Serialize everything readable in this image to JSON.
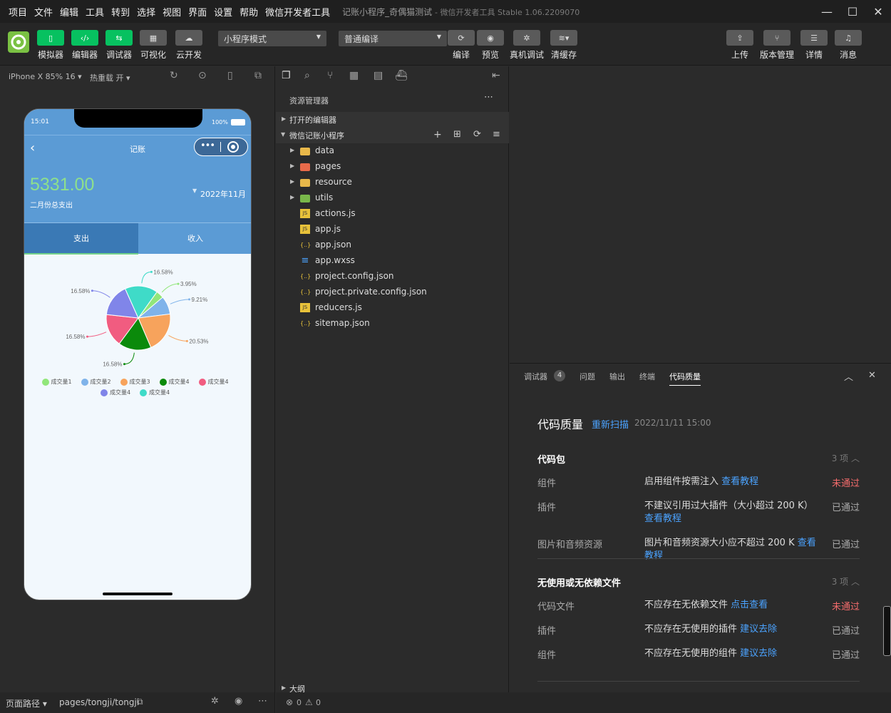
{
  "menu": [
    "项目",
    "文件",
    "编辑",
    "工具",
    "转到",
    "选择",
    "视图",
    "界面",
    "设置",
    "帮助",
    "微信开发者工具"
  ],
  "window": {
    "title": "记账小程序_奇偶猫测试",
    "subtitle": "- 微信开发者工具 Stable 1.06.2209070"
  },
  "toolbar": {
    "left_buttons": [
      {
        "label": "模拟器",
        "icon": "phone-icon"
      },
      {
        "label": "编辑器",
        "icon": "code-icon"
      },
      {
        "label": "调试器",
        "icon": "sliders-icon"
      },
      {
        "label": "可视化",
        "icon": "layout-icon"
      },
      {
        "label": "云开发",
        "icon": "cloud-icon"
      }
    ],
    "mode_select": "小程序模式",
    "compile_select": "普通编译",
    "mid_buttons": [
      {
        "label": "编译",
        "icon": "refresh-icon"
      },
      {
        "label": "预览",
        "icon": "eye-icon"
      },
      {
        "label": "真机调试",
        "icon": "bug-icon"
      },
      {
        "label": "清缓存",
        "icon": "layers-icon"
      }
    ],
    "right_buttons": [
      {
        "label": "上传",
        "icon": "upload-icon"
      },
      {
        "label": "版本管理",
        "icon": "branch-icon"
      },
      {
        "label": "详情",
        "icon": "menu-icon"
      },
      {
        "label": "消息",
        "icon": "bell-icon"
      }
    ]
  },
  "simulator": {
    "device": "iPhone X 85% 16 ▾",
    "hot_reload": "热重载 开 ▾",
    "phone": {
      "time": "15:01",
      "battery": "100%",
      "nav_title": "记账",
      "total": "5331.00",
      "total_label": "二月份总支出",
      "month": "2022年11月",
      "tab_out": "支出",
      "tab_in": "收入"
    }
  },
  "chart_data": {
    "type": "pie",
    "slices": [
      {
        "name": "成交量1",
        "value": 3.95,
        "label": "3.95%",
        "color": "#91e67a"
      },
      {
        "name": "成交量2",
        "value": 9.21,
        "label": "9.21%",
        "color": "#7fb3ea"
      },
      {
        "name": "成交量3",
        "value": 20.53,
        "label": "20.53%",
        "color": "#f7a35c"
      },
      {
        "name": "成交量4",
        "value": 16.58,
        "label": "16.58%",
        "color": "#0b8a0b"
      },
      {
        "name": "成交量4",
        "value": 16.58,
        "label": "16.58%",
        "color": "#f15c80"
      },
      {
        "name": "成交量4",
        "value": 16.58,
        "label": "16.58%",
        "color": "#8085e9"
      },
      {
        "name": "成交量4",
        "value": 16.58,
        "label": "16.58%",
        "color": "#3fdbc8"
      }
    ]
  },
  "statusbar": {
    "page_path_label": "页面路径 ▾",
    "page_path": "pages/tongji/tongji",
    "errors": "0",
    "warnings": "0"
  },
  "explorer": {
    "title": "资源管理器",
    "open_editors": "打开的编辑器",
    "project": "微信记账小程序",
    "outline": "大纲",
    "files": [
      {
        "name": "data",
        "type": "folder",
        "color": "#e8b84a"
      },
      {
        "name": "pages",
        "type": "folder",
        "color": "#e86a4a"
      },
      {
        "name": "resource",
        "type": "folder",
        "color": "#e8b84a"
      },
      {
        "name": "utils",
        "type": "folder",
        "color": "#79b84a"
      },
      {
        "name": "actions.js",
        "type": "js"
      },
      {
        "name": "app.js",
        "type": "js"
      },
      {
        "name": "app.json",
        "type": "json"
      },
      {
        "name": "app.wxss",
        "type": "wxss"
      },
      {
        "name": "project.config.json",
        "type": "json"
      },
      {
        "name": "project.private.config.json",
        "type": "json"
      },
      {
        "name": "reducers.js",
        "type": "js"
      },
      {
        "name": "sitemap.json",
        "type": "json"
      }
    ]
  },
  "debug_tabs": {
    "debugger": "调试器",
    "debugger_badge": "4",
    "issues": "问题",
    "output": "输出",
    "terminal": "终端",
    "quality": "代码质量"
  },
  "quality": {
    "title": "代码质量",
    "rescan": "重新扫描",
    "date": "2022/11/11 15:00",
    "sections": [
      {
        "name": "代码包",
        "count": "3 项",
        "rows": [
          {
            "key": "组件",
            "text": "启用组件按需注入",
            "link": "查看教程",
            "status": "未通过",
            "fail": true
          },
          {
            "key": "插件",
            "text": "不建议引用过大插件（大小超过 200 K）",
            "link": "查看教程",
            "status": "已通过",
            "fail": false
          },
          {
            "key": "图片和音频资源",
            "text": "图片和音频资源大小应不超过 200 K",
            "link": "查看教程",
            "status": "已通过",
            "fail": false
          }
        ]
      },
      {
        "name": "无使用或无依赖文件",
        "count": "3 项",
        "rows": [
          {
            "key": "代码文件",
            "text": "不应存在无依赖文件",
            "link": "点击查看",
            "status": "未通过",
            "fail": true
          },
          {
            "key": "插件",
            "text": "不应存在无使用的插件",
            "link": "建议去除",
            "status": "已通过",
            "fail": false
          },
          {
            "key": "组件",
            "text": "不应存在无使用的组件",
            "link": "建议去除",
            "status": "已通过",
            "fail": false
          }
        ]
      }
    ]
  }
}
